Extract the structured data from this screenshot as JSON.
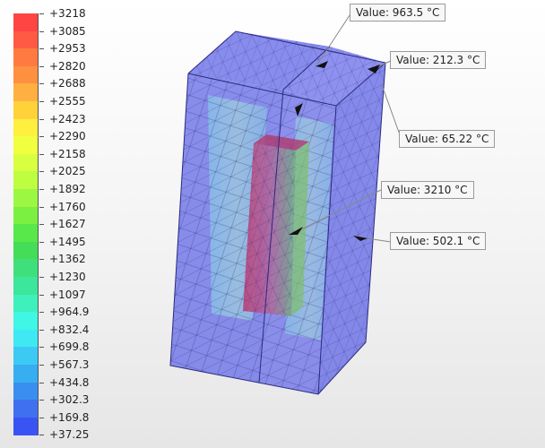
{
  "legend": {
    "ticks": [
      "+3218",
      "+3085",
      "+2953",
      "+2820",
      "+2688",
      "+2555",
      "+2423",
      "+2290",
      "+2158",
      "+2025",
      "+1892",
      "+1760",
      "+1627",
      "+1495",
      "+1362",
      "+1230",
      "+1097",
      "+964.9",
      "+832.4",
      "+699.8",
      "+567.3",
      "+434.8",
      "+302.3",
      "+169.8",
      "+37.25"
    ],
    "colors": [
      "#ff4444",
      "#ff5a44",
      "#ff7a40",
      "#ff9040",
      "#ffb040",
      "#ffd23a",
      "#fff040",
      "#f0ff40",
      "#d8ff40",
      "#bdff40",
      "#9cf742",
      "#7cf040",
      "#58e84a",
      "#44dd58",
      "#3fe07c",
      "#3ce69a",
      "#3ef0bc",
      "#40f6e4",
      "#40e8f4",
      "#3ccaf4",
      "#36aef0",
      "#3a8ef0",
      "#3f70f0",
      "#3a54f4",
      "#3a3af6"
    ]
  },
  "probes": [
    {
      "text": "Value: 963.5 °C"
    },
    {
      "text": "Value: 212.3 °C"
    },
    {
      "text": "Value: 65.22 °C"
    },
    {
      "text": "Value: 3210 °C"
    },
    {
      "text": "Value: 502.1 °C"
    }
  ],
  "colors": {
    "mesh_face": "#6f74e8",
    "mesh_line": "#23246e",
    "hot_core": "#c23a73",
    "cool_inner": "#8fd6e6"
  }
}
